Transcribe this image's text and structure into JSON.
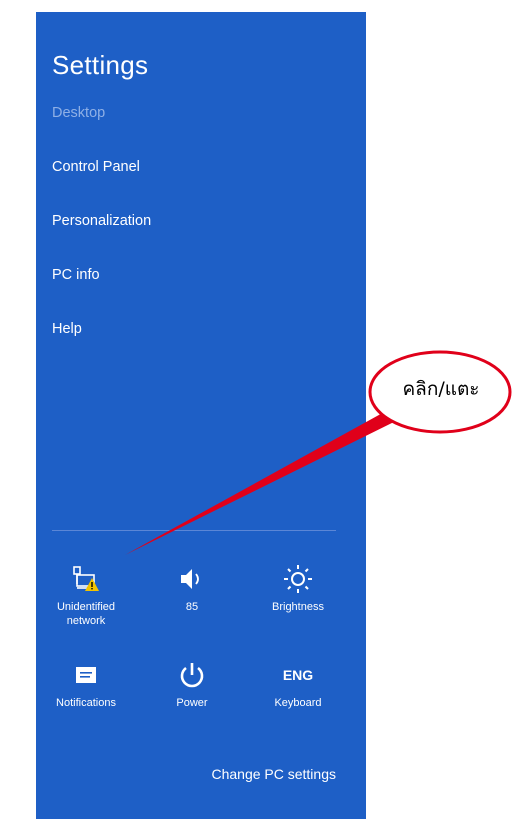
{
  "panel": {
    "title": "Settings",
    "menu": [
      {
        "label": "Desktop",
        "dim": true
      },
      {
        "label": "Control Panel"
      },
      {
        "label": "Personalization"
      },
      {
        "label": "PC info"
      },
      {
        "label": "Help"
      }
    ],
    "tiles": [
      {
        "icon": "network-warning-icon",
        "label": "Unidentified network"
      },
      {
        "icon": "volume-icon",
        "label": "85"
      },
      {
        "icon": "brightness-icon",
        "label": "Brightness"
      },
      {
        "icon": "notifications-icon",
        "label": "Notifications"
      },
      {
        "icon": "power-icon",
        "label": "Power"
      },
      {
        "icon": "keyboard-icon",
        "label": "Keyboard",
        "icon_text": "ENG"
      }
    ],
    "change_settings": "Change PC settings"
  },
  "callout": {
    "text": "คลิก/แตะ"
  },
  "colors": {
    "panel_bg": "#1e5fc6",
    "callout_line": "#e0001a",
    "warning": "#f2c300"
  }
}
